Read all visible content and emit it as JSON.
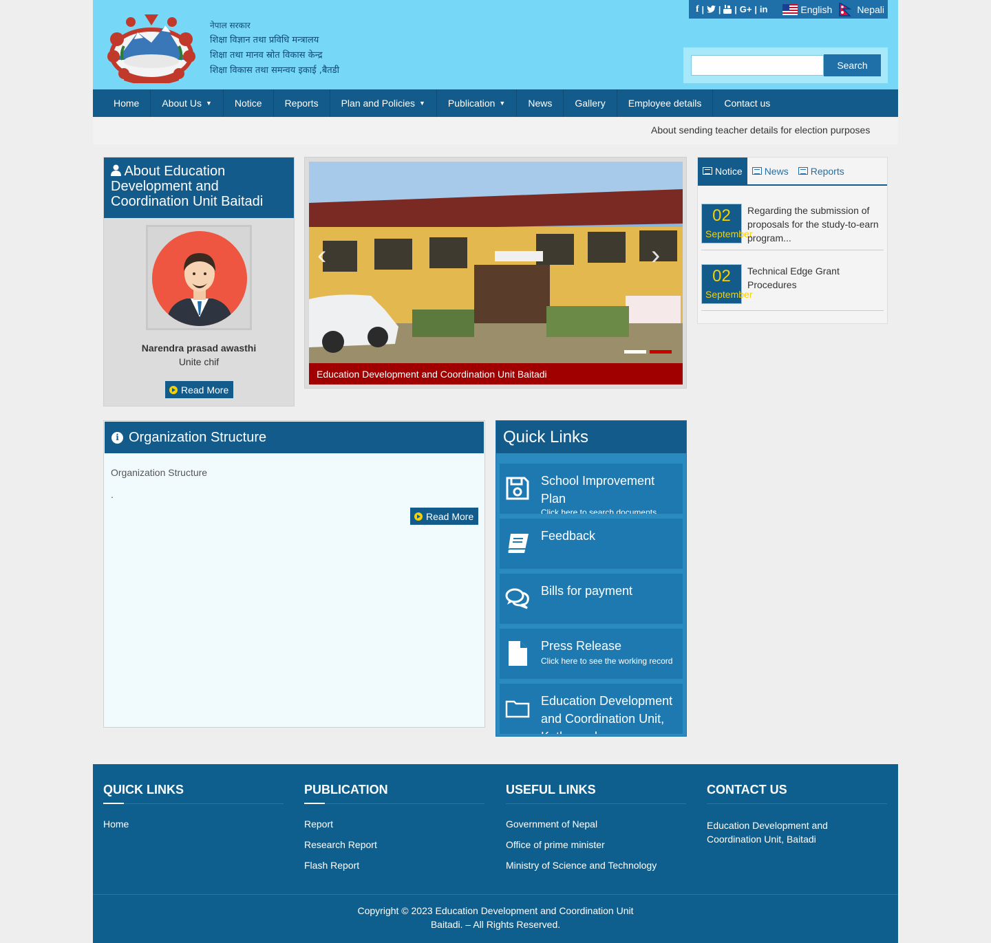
{
  "header": {
    "line1": "नेपाल सरकार",
    "line2": "शिक्षा विज्ञान तथा प्रविधि मन्त्रालय",
    "line3": "शिक्षा तथा मानव स्रोत विकास केन्द्र",
    "line4": "शिक्षा विकास तथा समन्वय इकाई ,बैतडी",
    "social_sep": "|",
    "lang_english": "English",
    "lang_nepali": "Nepali",
    "search_placeholder": "",
    "search_button": "Search"
  },
  "nav": {
    "items": [
      {
        "label": "Home"
      },
      {
        "label": "About Us",
        "dropdown": true
      },
      {
        "label": "Notice"
      },
      {
        "label": "Reports"
      },
      {
        "label": "Plan and Policies",
        "dropdown": true
      },
      {
        "label": "Publication",
        "dropdown": true
      },
      {
        "label": "News"
      },
      {
        "label": "Gallery"
      },
      {
        "label": "Employee details"
      },
      {
        "label": "Contact us"
      }
    ]
  },
  "ticker": {
    "text": "About sending teacher details for election purposes"
  },
  "about": {
    "title": "About Education Development and Coordination Unit Baitadi",
    "name": "Narendra prasad awasthi",
    "role": "Unite chif",
    "read_more": "Read More"
  },
  "slider": {
    "caption": "Education Development and Coordination Unit Baitadi",
    "slide_count": 2,
    "active_slide": 2
  },
  "tabs": {
    "notice": "Notice",
    "news": "News",
    "reports": "Reports",
    "items": [
      {
        "day": "02",
        "month": "September",
        "text": "Regarding the submission of proposals for the study-to-earn program..."
      },
      {
        "day": "02",
        "month": "September",
        "text": "Technical Edge Grant Procedures"
      }
    ]
  },
  "org": {
    "title": "Organization Structure",
    "body": "Organization Structure",
    "body2": ".",
    "read_more": "Read More"
  },
  "quick_links": {
    "title": "Quick Links",
    "items": [
      {
        "title": "School Improvement Plan",
        "sub": "Click here to search documents",
        "icon": "floppy-icon"
      },
      {
        "title": "Feedback",
        "sub": "",
        "icon": "book-icon"
      },
      {
        "title": "Bills for payment",
        "sub": "",
        "icon": "comments-icon"
      },
      {
        "title": "Press Release",
        "sub": "Click here to see the working record",
        "icon": "file-icon"
      },
      {
        "title": "Education Development and Coordination Unit, Kathmandu",
        "sub": "",
        "icon": "folder-icon"
      }
    ]
  },
  "footer": {
    "quick_links_title": "QUICK LINKS",
    "quick_links": [
      "Home"
    ],
    "publication_title": "PUBLICATION",
    "publication": [
      "Report",
      "Research Report",
      "Flash Report"
    ],
    "useful_title": "USEFUL LINKS",
    "useful": [
      "Government of Nepal",
      "Office of prime minister",
      "Ministry of Science and Technology"
    ],
    "contact_title": "CONTACT US",
    "contact_address": " Education Development and Coordination Unit, Baitadi",
    "copyright_line1": "Copyright © 2023 Education Development and Coordination Unit",
    "copyright_line2": "Baitadi. – All Rights Reserved."
  },
  "colors": {
    "header_bg": "#76d7f7",
    "nav_bg": "#125b8b",
    "accent_yellow": "#f6d200",
    "slider_caption": "#a00000",
    "footer_bg": "#0e5f8e"
  }
}
